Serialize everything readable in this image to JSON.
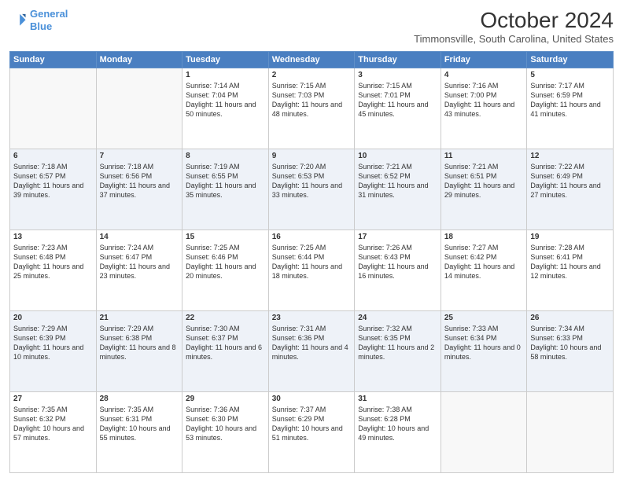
{
  "header": {
    "logo_line1": "General",
    "logo_line2": "Blue",
    "main_title": "October 2024",
    "subtitle": "Timmonsville, South Carolina, United States"
  },
  "days_of_week": [
    "Sunday",
    "Monday",
    "Tuesday",
    "Wednesday",
    "Thursday",
    "Friday",
    "Saturday"
  ],
  "weeks": [
    [
      {
        "day": "",
        "info": ""
      },
      {
        "day": "",
        "info": ""
      },
      {
        "day": "1",
        "info": "Sunrise: 7:14 AM\nSunset: 7:04 PM\nDaylight: 11 hours and 50 minutes."
      },
      {
        "day": "2",
        "info": "Sunrise: 7:15 AM\nSunset: 7:03 PM\nDaylight: 11 hours and 48 minutes."
      },
      {
        "day": "3",
        "info": "Sunrise: 7:15 AM\nSunset: 7:01 PM\nDaylight: 11 hours and 45 minutes."
      },
      {
        "day": "4",
        "info": "Sunrise: 7:16 AM\nSunset: 7:00 PM\nDaylight: 11 hours and 43 minutes."
      },
      {
        "day": "5",
        "info": "Sunrise: 7:17 AM\nSunset: 6:59 PM\nDaylight: 11 hours and 41 minutes."
      }
    ],
    [
      {
        "day": "6",
        "info": "Sunrise: 7:18 AM\nSunset: 6:57 PM\nDaylight: 11 hours and 39 minutes."
      },
      {
        "day": "7",
        "info": "Sunrise: 7:18 AM\nSunset: 6:56 PM\nDaylight: 11 hours and 37 minutes."
      },
      {
        "day": "8",
        "info": "Sunrise: 7:19 AM\nSunset: 6:55 PM\nDaylight: 11 hours and 35 minutes."
      },
      {
        "day": "9",
        "info": "Sunrise: 7:20 AM\nSunset: 6:53 PM\nDaylight: 11 hours and 33 minutes."
      },
      {
        "day": "10",
        "info": "Sunrise: 7:21 AM\nSunset: 6:52 PM\nDaylight: 11 hours and 31 minutes."
      },
      {
        "day": "11",
        "info": "Sunrise: 7:21 AM\nSunset: 6:51 PM\nDaylight: 11 hours and 29 minutes."
      },
      {
        "day": "12",
        "info": "Sunrise: 7:22 AM\nSunset: 6:49 PM\nDaylight: 11 hours and 27 minutes."
      }
    ],
    [
      {
        "day": "13",
        "info": "Sunrise: 7:23 AM\nSunset: 6:48 PM\nDaylight: 11 hours and 25 minutes."
      },
      {
        "day": "14",
        "info": "Sunrise: 7:24 AM\nSunset: 6:47 PM\nDaylight: 11 hours and 23 minutes."
      },
      {
        "day": "15",
        "info": "Sunrise: 7:25 AM\nSunset: 6:46 PM\nDaylight: 11 hours and 20 minutes."
      },
      {
        "day": "16",
        "info": "Sunrise: 7:25 AM\nSunset: 6:44 PM\nDaylight: 11 hours and 18 minutes."
      },
      {
        "day": "17",
        "info": "Sunrise: 7:26 AM\nSunset: 6:43 PM\nDaylight: 11 hours and 16 minutes."
      },
      {
        "day": "18",
        "info": "Sunrise: 7:27 AM\nSunset: 6:42 PM\nDaylight: 11 hours and 14 minutes."
      },
      {
        "day": "19",
        "info": "Sunrise: 7:28 AM\nSunset: 6:41 PM\nDaylight: 11 hours and 12 minutes."
      }
    ],
    [
      {
        "day": "20",
        "info": "Sunrise: 7:29 AM\nSunset: 6:39 PM\nDaylight: 11 hours and 10 minutes."
      },
      {
        "day": "21",
        "info": "Sunrise: 7:29 AM\nSunset: 6:38 PM\nDaylight: 11 hours and 8 minutes."
      },
      {
        "day": "22",
        "info": "Sunrise: 7:30 AM\nSunset: 6:37 PM\nDaylight: 11 hours and 6 minutes."
      },
      {
        "day": "23",
        "info": "Sunrise: 7:31 AM\nSunset: 6:36 PM\nDaylight: 11 hours and 4 minutes."
      },
      {
        "day": "24",
        "info": "Sunrise: 7:32 AM\nSunset: 6:35 PM\nDaylight: 11 hours and 2 minutes."
      },
      {
        "day": "25",
        "info": "Sunrise: 7:33 AM\nSunset: 6:34 PM\nDaylight: 11 hours and 0 minutes."
      },
      {
        "day": "26",
        "info": "Sunrise: 7:34 AM\nSunset: 6:33 PM\nDaylight: 10 hours and 58 minutes."
      }
    ],
    [
      {
        "day": "27",
        "info": "Sunrise: 7:35 AM\nSunset: 6:32 PM\nDaylight: 10 hours and 57 minutes."
      },
      {
        "day": "28",
        "info": "Sunrise: 7:35 AM\nSunset: 6:31 PM\nDaylight: 10 hours and 55 minutes."
      },
      {
        "day": "29",
        "info": "Sunrise: 7:36 AM\nSunset: 6:30 PM\nDaylight: 10 hours and 53 minutes."
      },
      {
        "day": "30",
        "info": "Sunrise: 7:37 AM\nSunset: 6:29 PM\nDaylight: 10 hours and 51 minutes."
      },
      {
        "day": "31",
        "info": "Sunrise: 7:38 AM\nSunset: 6:28 PM\nDaylight: 10 hours and 49 minutes."
      },
      {
        "day": "",
        "info": ""
      },
      {
        "day": "",
        "info": ""
      }
    ]
  ]
}
